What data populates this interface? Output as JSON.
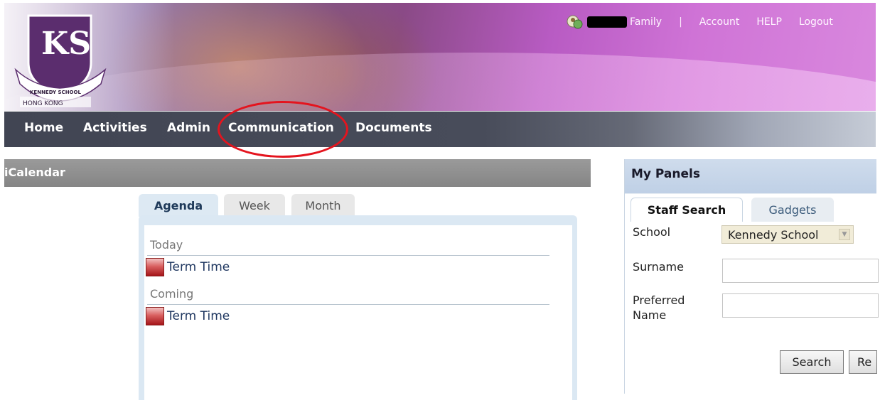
{
  "logo": {
    "letters": "KS",
    "ribbon": "KENNEDY SCHOOL",
    "location": "HONG KONG"
  },
  "top_nav": {
    "family_label": "Family",
    "separator": "|",
    "account": "Account",
    "help": "HELP",
    "logout": "Logout"
  },
  "main_nav": [
    "Home",
    "Activities",
    "Admin",
    "Communication",
    "Documents"
  ],
  "calendar": {
    "title": "iCalendar",
    "tabs": [
      "Agenda",
      "Week",
      "Month"
    ],
    "active_tab": "Agenda",
    "sections": [
      {
        "label": "Today",
        "events": [
          "Term Time"
        ]
      },
      {
        "label": "Coming",
        "events": [
          "Term Time"
        ]
      }
    ],
    "event_color": "#c0282e"
  },
  "panels": {
    "title": "My Panels",
    "tabs": [
      "Staff Search",
      "Gadgets"
    ],
    "active_tab": "Staff Search",
    "school_label": "School",
    "school_value": "Kennedy School",
    "surname_label": "Surname",
    "surname_value": "",
    "preferred_label_1": "Preferred",
    "preferred_label_2": "Name",
    "preferred_value": "",
    "search_button": "Search",
    "reset_button": "Re"
  },
  "colors": {
    "nav_bg": "#414553",
    "highlight_circle": "#e4141e",
    "school_purple": "#5b2d6e"
  }
}
